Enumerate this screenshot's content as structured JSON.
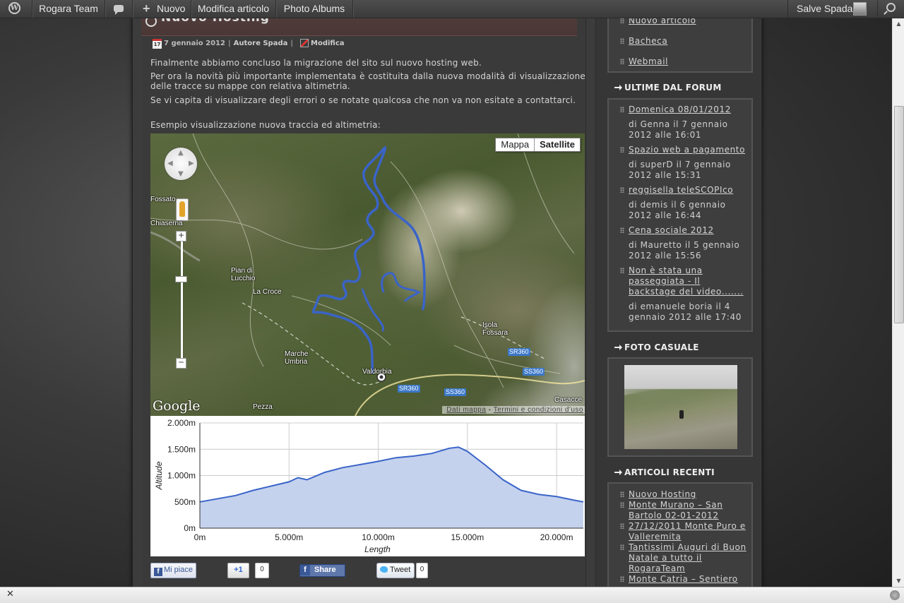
{
  "adminbar": {
    "site_name": "Rogara Team",
    "new_label": "Nuovo",
    "edit_label": "Modifica articolo",
    "albums_label": "Photo Albums",
    "greeting": "Salve Spada"
  },
  "post": {
    "title": "Nuovo Hosting",
    "date": "7 gennaio 2012",
    "calendar_day": "17",
    "author": "Autore Spada",
    "edit_link": "Modifica",
    "paragraphs": [
      "Finalmente abbiamo concluso la migrazione del sito sul nuovo hosting web.",
      "Per ora la novità più importante implementata è costituita dalla nuova modalità di visualizzazione delle tracce su mappe con relativa altimetria.",
      "Se vi capita di visualizzare degli errori o se notate qualcosa che non va non esitate a contattarci.",
      "Esempio visualizzazione nuova traccia ed altimetria:"
    ]
  },
  "map": {
    "type_map": "Mappa",
    "type_satellite": "Satellite",
    "zoom_in": "+",
    "zoom_out": "−",
    "places": [
      "Fossato",
      "Chiaserna",
      "Pian di Lucchio",
      "La Croce",
      "Isola Fossara",
      "Marche Umbria",
      "Valdorbia",
      "Pezza",
      "Casacce"
    ],
    "roads": [
      "SR360",
      "SS360",
      "SR360",
      "SS360"
    ],
    "logo": "Google",
    "footer_data": "Dati mappa",
    "footer_sep": " - ",
    "footer_terms": "Termini e condizioni d'uso",
    "track_color": "#3a64c8"
  },
  "chart_data": {
    "type": "area",
    "xlabel": "Length",
    "ylabel": "Altitude",
    "x_ticks": [
      "0m",
      "5.000m",
      "10.000m",
      "15.000m",
      "20.000m"
    ],
    "y_ticks": [
      "0m",
      "500m",
      "1.000m",
      "1.500m",
      "2.000m"
    ],
    "xlim": [
      0,
      21500
    ],
    "ylim": [
      0,
      2000
    ],
    "grid": true,
    "fill_color": "#c5d2ee",
    "line_color": "#3a64c8",
    "x": [
      0,
      1000,
      2000,
      3000,
      4000,
      5000,
      5500,
      6000,
      7000,
      8000,
      9000,
      10000,
      11000,
      12000,
      13000,
      14000,
      14500,
      15000,
      16000,
      17000,
      18000,
      19000,
      20000,
      21000,
      21500
    ],
    "values": [
      500,
      560,
      620,
      720,
      800,
      880,
      960,
      920,
      1060,
      1150,
      1210,
      1270,
      1340,
      1370,
      1420,
      1520,
      1540,
      1460,
      1200,
      920,
      720,
      640,
      600,
      530,
      500
    ]
  },
  "social": {
    "fb_like": "Mi piace",
    "gplus": "+1",
    "gplus_count": "0",
    "fb_share": "Share",
    "tweet": "Tweet",
    "tweet_count": "0"
  },
  "sidebar": {
    "meta_links": [
      "Nuovo articolo",
      "Bacheca",
      "Webmail"
    ],
    "forum_title": "ULTIME DAL FORUM",
    "forum_items": [
      {
        "link": "Domenica 08/01/2012",
        "info": "di Genna il 7 gennaio 2012 alle 16:01"
      },
      {
        "link": "Spazio web a pagamento",
        "info": "di superD il 7 gennaio 2012 alle 15:31"
      },
      {
        "link": "reggisella teleSCOPIco",
        "info": "di demis il 6 gennaio 2012 alle 16:44"
      },
      {
        "link": "Cena sociale 2012",
        "info": "di Mauretto il 5 gennaio 2012 alle 15:56"
      },
      {
        "link": "Non è stata una passeggiata - Il backstage del video.......",
        "info": "di emanuele boria il 4 gennaio 2012 alle 17:40"
      }
    ],
    "photo_title": "FOTO CASUALE",
    "recent_title": "ARTICOLI RECENTI",
    "recent_items": [
      "Nuovo Hosting",
      "Monte Murano – San Bartolo 02-01-2012",
      "27/12/2011 Monte Puro e Valleremita",
      "Tantissimi Auguri di Buon Natale a tutto il RogaraTeam",
      "Monte Catria – Sentiero"
    ]
  }
}
